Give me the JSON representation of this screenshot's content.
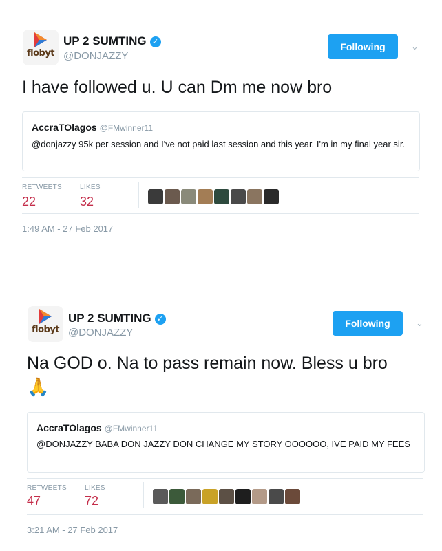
{
  "tweets": [
    {
      "avatar_text": "flobyt",
      "name": "UP 2 SUMTING",
      "handle": "@DONJAZZY",
      "follow_label": "Following",
      "text": "I have followed u. U can Dm me now bro",
      "emoji": "",
      "quote": {
        "name": "AccraTOlagos",
        "handle": "@FMwinner11",
        "text": "@donjazzy 95k per session and I've not paid last session and this year. I'm in my final year sir."
      },
      "retweets_label": "RETWEETS",
      "retweets": "22",
      "likes_label": "LIKES",
      "likes": "32",
      "liker_colors": [
        "#3a3a3a",
        "#6b5a4e",
        "#8a8a7a",
        "#a37d55",
        "#2e4a3e",
        "#4a4a4a",
        "#8a7560",
        "#2a2a2a"
      ],
      "timestamp": "1:49 AM - 27 Feb 2017"
    },
    {
      "avatar_text": "flobyt",
      "name": "UP 2 SUMTING",
      "handle": "@DONJAZZY",
      "follow_label": "Following",
      "text": "Na GOD o. Na to pass remain now. Bless u bro",
      "emoji": "🙏",
      "quote": {
        "name": "AccraTOlagos",
        "handle": "@FMwinner11",
        "text": "@DONJAZZY BABA DON JAZZY DON CHANGE MY STORY OOOOOO,  IVE PAID MY FEES"
      },
      "retweets_label": "RETWEETS",
      "retweets": "47",
      "likes_label": "LIKES",
      "likes": "72",
      "liker_colors": [
        "#5a5a5a",
        "#3c5a3a",
        "#7a6a5a",
        "#c9a227",
        "#5c5045",
        "#1e1e1e",
        "#b39a88",
        "#4a4a4a",
        "#6b4a3a"
      ],
      "timestamp": "3:21 AM - 27 Feb 2017"
    }
  ],
  "colors": {
    "accent": "#1da1f2",
    "stat": "#c42d4a",
    "muted": "#8899a6"
  }
}
